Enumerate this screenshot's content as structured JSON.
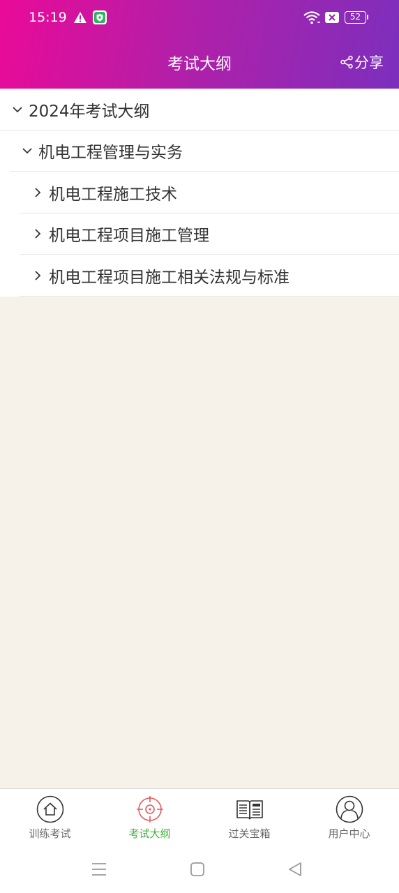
{
  "status_bar": {
    "time": "15:19",
    "battery": "52",
    "icons": [
      "warning-icon",
      "shield-icon",
      "wifi-icon",
      "sim-off-icon",
      "battery-icon"
    ]
  },
  "header": {
    "title": "考试大纲",
    "share_label": "分享",
    "gradient_colors": [
      "#ea0a98",
      "#7c2fbd"
    ]
  },
  "tree": {
    "root": {
      "label": "2024年考试大纲",
      "expanded": true
    },
    "subject": {
      "label": "机电工程管理与实务",
      "expanded": true
    },
    "chapters": [
      {
        "label": "机电工程施工技术",
        "expanded": false
      },
      {
        "label": "机电工程项目施工管理",
        "expanded": false
      },
      {
        "label": "机电工程项目施工相关法规与标准",
        "expanded": false
      }
    ]
  },
  "tabbar": {
    "active_color": "#43b13f",
    "tabs": [
      {
        "label": "训练考试",
        "icon": "home-icon",
        "active": false
      },
      {
        "label": "考试大纲",
        "icon": "target-icon",
        "active": true
      },
      {
        "label": "过关宝箱",
        "icon": "news-book-icon",
        "active": false
      },
      {
        "label": "用户中心",
        "icon": "user-icon",
        "active": false
      }
    ]
  },
  "system_nav": [
    "menu-icon",
    "home-square-icon",
    "back-triangle-icon"
  ]
}
